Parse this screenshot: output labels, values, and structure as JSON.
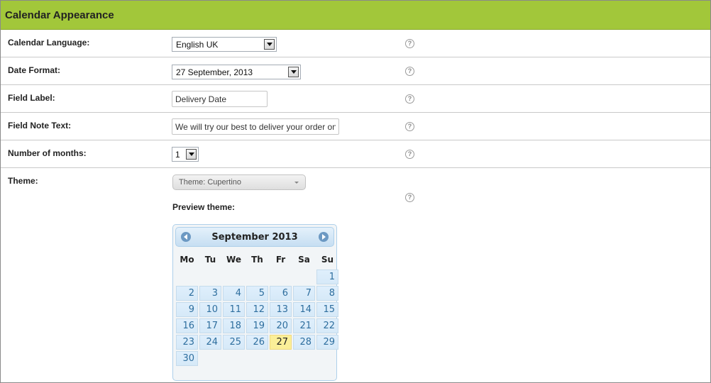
{
  "header": {
    "title": "Calendar Appearance"
  },
  "help_icon_glyph": "?",
  "fields": {
    "language": {
      "label": "Calendar Language:",
      "value": "English UK"
    },
    "date_format": {
      "label": "Date Format:",
      "value": "27 September, 2013"
    },
    "field_label": {
      "label": "Field Label:",
      "value": "Delivery Date"
    },
    "field_note": {
      "label": "Field Note Text:",
      "value": "We will try our best to deliver your order on"
    },
    "months": {
      "label": "Number of months:",
      "value": "1"
    },
    "theme": {
      "label": "Theme:",
      "value": "Theme: Cupertino",
      "preview_label": "Preview theme:"
    }
  },
  "calendar": {
    "month_title": "September 2013",
    "weekdays": [
      "Mo",
      "Tu",
      "We",
      "Th",
      "Fr",
      "Sa",
      "Su"
    ],
    "weeks": [
      [
        "",
        "",
        "",
        "",
        "",
        "",
        "1"
      ],
      [
        "2",
        "3",
        "4",
        "5",
        "6",
        "7",
        "8"
      ],
      [
        "9",
        "10",
        "11",
        "12",
        "13",
        "14",
        "15"
      ],
      [
        "16",
        "17",
        "18",
        "19",
        "20",
        "21",
        "22"
      ],
      [
        "23",
        "24",
        "25",
        "26",
        "27",
        "28",
        "29"
      ],
      [
        "30",
        "",
        "",
        "",
        "",
        "",
        ""
      ]
    ],
    "highlighted_day": "27"
  },
  "colors": {
    "header_bg": "#a2c73a",
    "calendar_day_bg": "#dfeffc",
    "calendar_day_text": "#2e6e9e",
    "calendar_today_bg": "#fbef98"
  },
  "icons": {
    "help": "help-icon",
    "prev": "chevron-left-icon",
    "next": "chevron-right-icon",
    "dropdown": "chevron-down-icon"
  }
}
